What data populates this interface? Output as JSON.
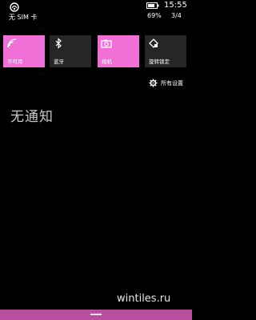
{
  "status_bar": {
    "carrier": "无 SIM 卡",
    "time": "15:55",
    "battery_percent": "69%",
    "page_indicator": "3/4",
    "icons": [
      "signal-icon",
      "battery-icon"
    ]
  },
  "quick_actions": [
    {
      "label": "不可用",
      "icon": "wifi-icon",
      "active": true
    },
    {
      "label": "蓝牙",
      "icon": "bluetooth-icon",
      "active": false
    },
    {
      "label": "相机",
      "icon": "camera-icon",
      "active": true
    },
    {
      "label": "旋转锁定",
      "icon": "rotation-lock-icon",
      "active": false
    }
  ],
  "all_settings": {
    "label": "所有设置",
    "icon": "gear-icon"
  },
  "notifications": {
    "empty_text": "无通知"
  },
  "watermark": "wintiles.ru",
  "colors": {
    "accent": "#f070d8",
    "tile_off": "#262626",
    "bottom_bar": "#b8509e"
  }
}
